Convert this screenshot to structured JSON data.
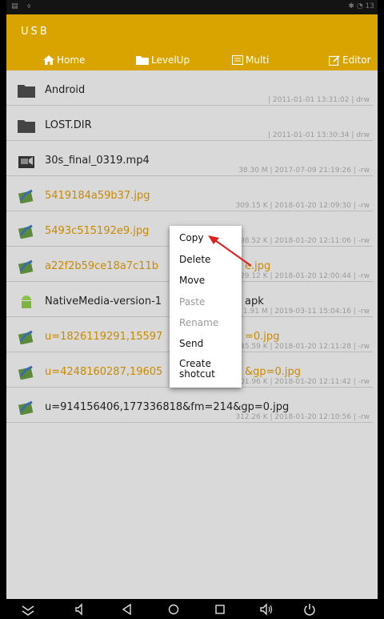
{
  "app": {
    "title": "USB"
  },
  "toolbar": {
    "home": "Home",
    "levelup": "LevelUp",
    "multi": "Multi",
    "editor": "Editor"
  },
  "files": [
    {
      "name": "Android",
      "meta": "| 2011-01-01 13:31:02 | drw",
      "kind": "folder"
    },
    {
      "name": "LOST.DIR",
      "meta": "| 2011-01-01 13:30:34 | drw",
      "kind": "folder"
    },
    {
      "name": "30s_final_0319.mp4",
      "meta": "38.30 M | 2017-07-09 21:19:26 | -rw",
      "kind": "video"
    },
    {
      "name": "5419184a59b37.jpg",
      "meta": "309.15 K | 2018-01-20 12:09:30 | -rw",
      "kind": "image"
    },
    {
      "name": "5493c515192e9.jpg",
      "meta": "398.52 K | 2018-01-20 12:11:06 | -rw",
      "kind": "image"
    },
    {
      "name": "a22f2b59ce18a7c11b",
      "name_tail": "e.jpg",
      "meta": "329.12 K | 2018-01-20 12:00:44 | -rw",
      "kind": "image"
    },
    {
      "name": "NativeMedia-version-1",
      "name_tail": "apk",
      "meta": "1.91 M | 2019-03-11 15:04:16 | -rw",
      "kind": "apk"
    },
    {
      "name": "u=1826119291,15597",
      "name_tail": "=0.jpg",
      "meta": "245.59 K | 2018-01-20 12:11:28 | -rw",
      "kind": "image"
    },
    {
      "name": "u=4248160287,19605",
      "name_tail": "&gp=0.jpg",
      "meta": "301.96 K | 2018-01-20 12:11:42 | -rw",
      "kind": "image"
    },
    {
      "name": "u=914156406,177336818&fm=214&gp=0.jpg",
      "meta": "312.26 K | 2018-01-20 12:10:56 | -rw",
      "kind": "image-dark"
    }
  ],
  "context_menu": {
    "copy": "Copy",
    "delete": "Delete",
    "move": "Move",
    "paste": "Paste",
    "rename": "Rename",
    "send": "Send",
    "create_line1": "Create",
    "create_line2": "shotcut"
  },
  "colors": {
    "accent": "#d9a400",
    "arrow": "#e02020",
    "image_name": "#c98a00"
  }
}
